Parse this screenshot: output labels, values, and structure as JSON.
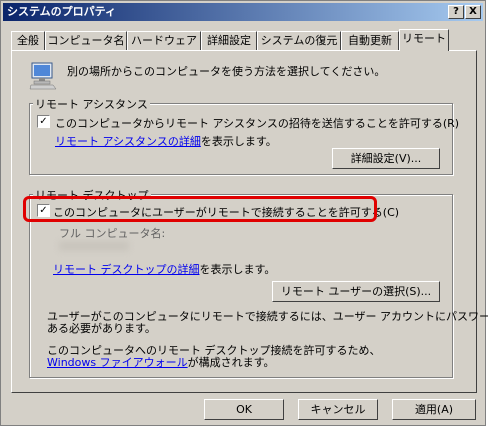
{
  "window": {
    "title": "システムのプロパティ",
    "help_glyph": "?",
    "close_glyph": "X"
  },
  "tabs": [
    "全般",
    "コンピュータ名",
    "ハードウェア",
    "詳細設定",
    "システムの復元",
    "自動更新",
    "リモート"
  ],
  "active_tab": "リモート",
  "intro_text": "別の場所からこのコンピュータを使う方法を選択してください。",
  "remote_assistance": {
    "group_label": "リモート アシスタンス",
    "checkbox_label": "このコンピュータからリモート アシスタンスの招待を送信することを許可する(R)",
    "checked": true,
    "link_text": "リモート アシスタンスの詳細",
    "link_suffix": "を表示します。",
    "advanced_button": "詳細設定(V)..."
  },
  "remote_desktop": {
    "group_label": "リモート デスクトップ",
    "checkbox_label": "このコンピュータにユーザーがリモートで接続することを許可する(C)",
    "checked": true,
    "full_name_label": "フル コンピュータ名:",
    "link_text": "リモート デスクトップの詳細",
    "link_suffix": "を表示します。",
    "select_users_button": "リモート ユーザーの選択(S)...",
    "password_note_line1": "ユーザーがこのコンピュータにリモートで接続するには、ユーザー アカウントにパスワードが",
    "password_note_line2": "ある必要があります。",
    "firewall_note_line1": "このコンピュータへのリモート デスクトップ接続を許可するため、",
    "firewall_link": "Windows ファイアウォール",
    "firewall_suffix": "が構成されます。"
  },
  "check_glyph": "✓",
  "buttons": {
    "ok": "OK",
    "cancel": "キャンセル",
    "apply": "適用(A)"
  },
  "colors": {
    "highlight": "#e00000",
    "link": "#0000ee",
    "title_start": "#0a246a",
    "face": "#d4d0c8"
  },
  "icons": [
    "computer-icon"
  ]
}
